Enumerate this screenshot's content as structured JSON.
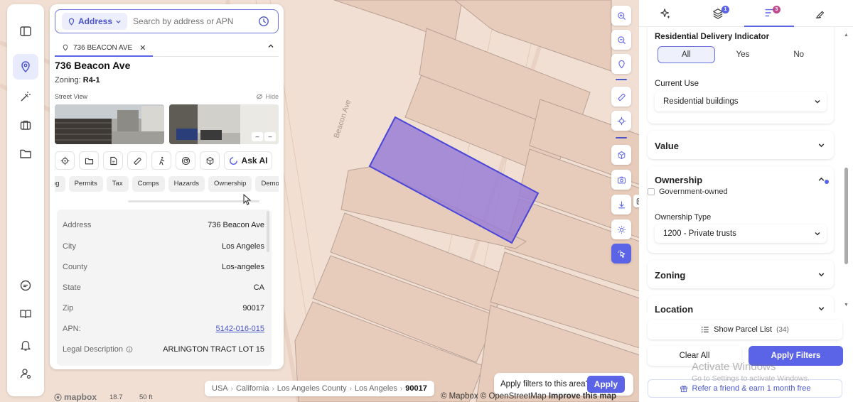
{
  "map": {
    "street_label": "Beacon Ave",
    "zoom_level": "18.7",
    "scale_label": "50 ft",
    "logo": "mapbox",
    "attribution_prefix": "© Mapbox © OpenStreetMap",
    "attribution_link": "Improve this map",
    "colors": {
      "land": "#f1dfd3",
      "parcel": "#e6c8b6",
      "selected_fill": "#9a7fd6",
      "selected_stroke": "#4a46d8"
    }
  },
  "rail": {
    "items": [
      {
        "icon": "sidebar-toggle-icon"
      },
      {
        "icon": "map-pin-icon",
        "active": true
      },
      {
        "icon": "magic-wand-icon"
      },
      {
        "icon": "briefcase-icon"
      },
      {
        "icon": "folder-icon"
      },
      {
        "icon": "chat-icon"
      },
      {
        "icon": "book-icon"
      },
      {
        "icon": "bell-icon"
      },
      {
        "icon": "user-settings-icon"
      }
    ]
  },
  "search": {
    "mode_label": "Address",
    "placeholder": "Search by address or APN",
    "value": ""
  },
  "property": {
    "tab_label": "736 BEACON AVE",
    "title": "736 Beacon Ave",
    "zoning_prefix": "Zoning:",
    "zoning_value": "R4-1",
    "street_view_label": "Street View",
    "hide_label": "Hide",
    "ask_ai_label": "Ask AI",
    "tools": [
      "target-icon",
      "folder-icon",
      "file-icon",
      "ruler-icon",
      "walk-icon",
      "radar-icon",
      "cube-icon"
    ],
    "chips": [
      "ng",
      "Permits",
      "Tax",
      "Comps",
      "Hazards",
      "Ownership",
      "Demo"
    ],
    "details": [
      {
        "key": "Address",
        "value": "736 Beacon Ave"
      },
      {
        "key": "City",
        "value": "Los Angeles"
      },
      {
        "key": "County",
        "value": "Los-angeles"
      },
      {
        "key": "State",
        "value": "CA"
      },
      {
        "key": "Zip",
        "value": "90017"
      },
      {
        "key": "APN:",
        "value": "5142-016-015",
        "link": true
      },
      {
        "key": "Legal Description",
        "value": "ARLINGTON TRACT LOT 15",
        "info": true
      }
    ]
  },
  "breadcrumb": {
    "items": [
      "USA",
      "California",
      "Los Angeles County",
      "Los Angeles"
    ],
    "current": "90017"
  },
  "apply_area": {
    "prompt": "Apply filters to this area?",
    "button": "Apply"
  },
  "filters": {
    "tabs": [
      {
        "icon": "sparkles-icon"
      },
      {
        "icon": "layers-icon",
        "badge": "1"
      },
      {
        "icon": "filter-list-icon",
        "badge": "3",
        "active": true
      },
      {
        "icon": "draw-icon"
      }
    ],
    "residential_delivery": {
      "title": "Residential Delivery Indicator",
      "options": [
        "All",
        "Yes",
        "No"
      ],
      "selected": "All"
    },
    "current_use": {
      "title": "Current Use",
      "value": "Residential buildings"
    },
    "value_section": {
      "title": "Value"
    },
    "ownership": {
      "title": "Ownership",
      "government_owned": "Government-owned",
      "type_title": "Ownership Type",
      "type_value": "1200 - Private trusts"
    },
    "zoning_section": {
      "title": "Zoning"
    },
    "location_section": {
      "title": "Location"
    },
    "show_list_label": "Show Parcel List",
    "parcel_count": "(34)",
    "clear_label": "Clear All",
    "apply_label": "Apply Filters",
    "referral_label": "Refer a friend & earn 1 month free"
  },
  "os_watermark": {
    "line1": "Activate Windows",
    "line2": "Go to Settings to activate Windows."
  },
  "accent_color": "#5b63e6"
}
